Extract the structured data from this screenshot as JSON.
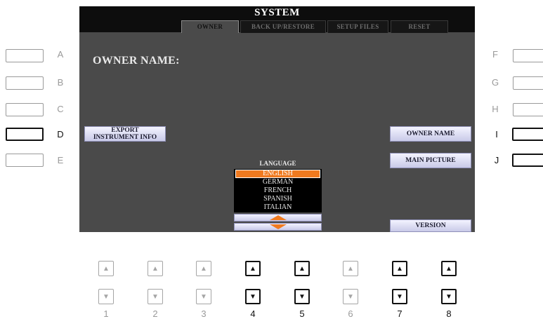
{
  "screen": {
    "title": "SYSTEM",
    "tabs": [
      {
        "label": "OWNER",
        "active": true
      },
      {
        "label": "BACK UP/RESTORE",
        "active": false
      },
      {
        "label": "SETUP FILES",
        "active": false
      },
      {
        "label": "RESET",
        "active": false
      }
    ],
    "owner_name_label": "OWNER NAME:",
    "export_button": {
      "line1": "EXPORT",
      "line2": "INSTRUMENT INFO"
    },
    "owner_name_button": "OWNER NAME",
    "main_picture_button": "MAIN PICTURE",
    "version_button": "VERSION",
    "language": {
      "label": "LANGUAGE",
      "options": [
        "ENGLISH",
        "GERMAN",
        "FRENCH",
        "SPANISH",
        "ITALIAN"
      ],
      "selected": "ENGLISH"
    }
  },
  "left_buttons": [
    "A",
    "B",
    "C",
    "D",
    "E"
  ],
  "right_buttons": [
    "F",
    "G",
    "H",
    "I",
    "J"
  ],
  "bottom_numbers": [
    "1",
    "2",
    "3",
    "4",
    "5",
    "6",
    "7",
    "8"
  ],
  "colors": {
    "screen_bg": "#4a4a4a",
    "title_bar": "#0d0d0d",
    "selection": "#f07a1f",
    "button_face": "#d9daf0"
  }
}
